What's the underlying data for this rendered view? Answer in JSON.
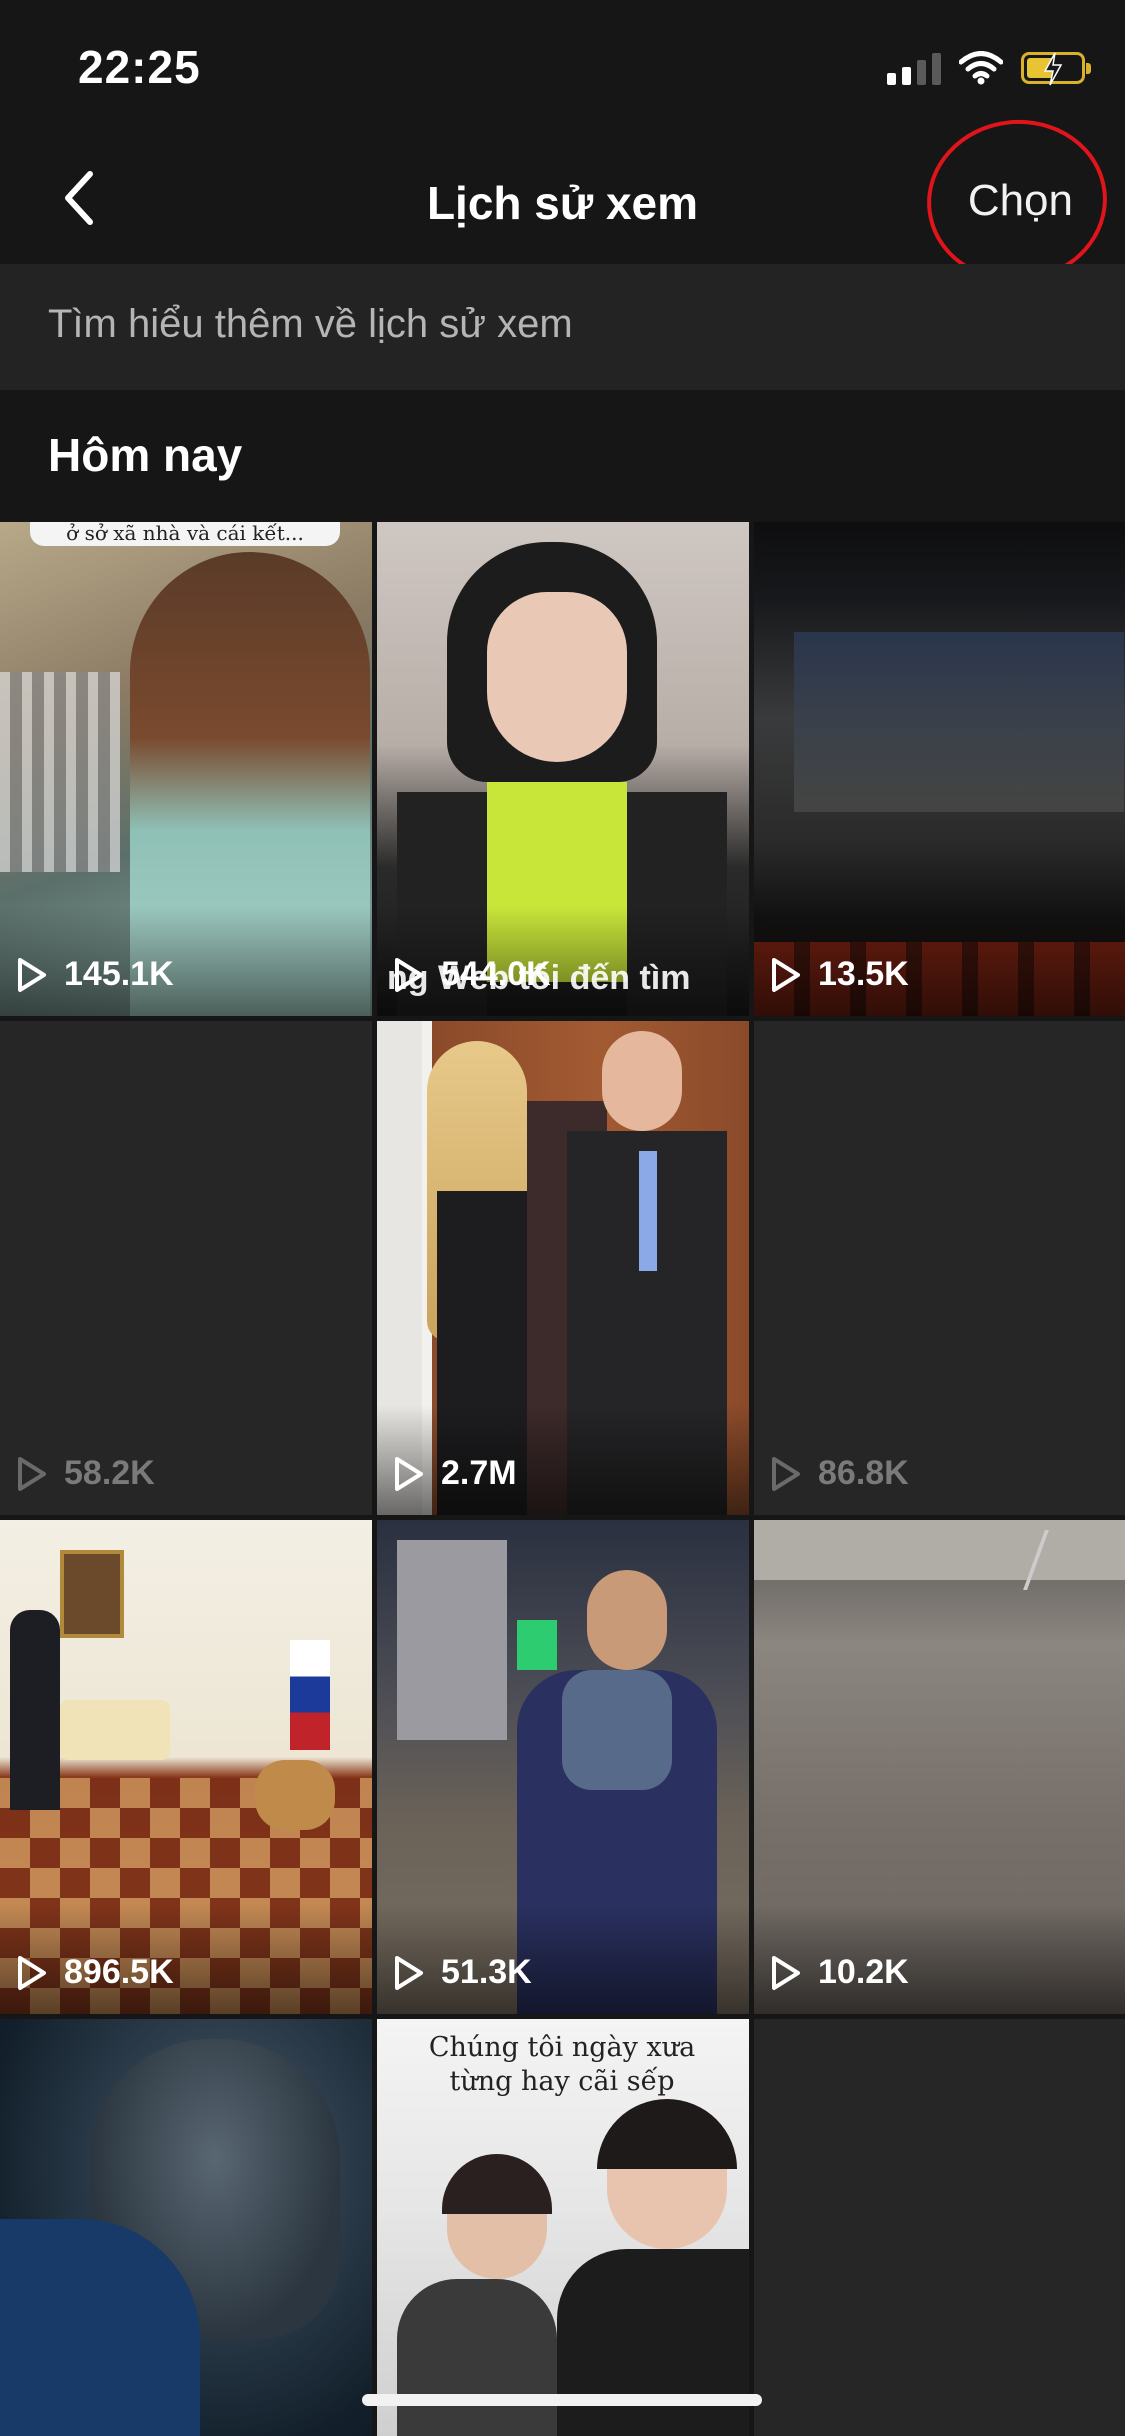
{
  "status": {
    "time": "22:25"
  },
  "header": {
    "title": "Lịch sử xem",
    "select_label": "Chọn"
  },
  "info": {
    "learn_more": "Tìm hiểu thêm về lịch sử xem"
  },
  "section": {
    "title": "Hôm nay"
  },
  "videos": [
    {
      "views": "145.1K",
      "caption": "ở sở xã nhà và cái kết..."
    },
    {
      "views": "544.0K",
      "overlay": "ng Web tôi đến tìm"
    },
    {
      "views": "13.5K"
    },
    {
      "views": "58.2K"
    },
    {
      "views": "2.7M"
    },
    {
      "views": "86.8K"
    },
    {
      "views": "896.5K"
    },
    {
      "views": "51.3K"
    },
    {
      "views": "10.2K"
    },
    {
      "views": ""
    },
    {
      "views": "",
      "caption": "Chúng tôi ngày xưa từng hay cãi sếp"
    },
    {
      "views": ""
    }
  ],
  "colors": {
    "background": "#161616",
    "annotation": "#e0141b",
    "battery": "#e8c332"
  }
}
